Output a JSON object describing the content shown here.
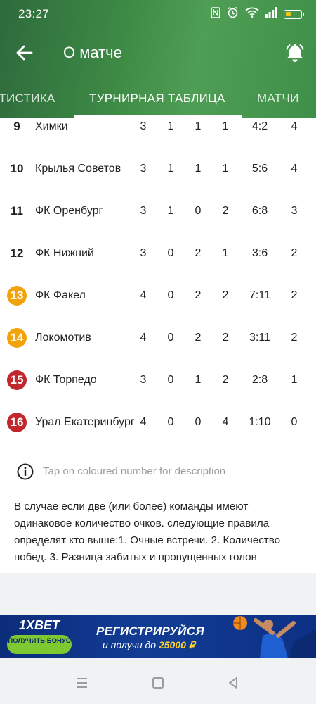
{
  "status_bar": {
    "time": "23:27"
  },
  "app_bar": {
    "title": "О матче"
  },
  "tabs": [
    {
      "label": "АТИСТИКА"
    },
    {
      "label": "ТУРНИРНАЯ ТАБЛИЦА"
    },
    {
      "label": "МАТЧИ"
    }
  ],
  "standings": [
    {
      "pos": "9",
      "team": "Химки",
      "p": "3",
      "w": "1",
      "d": "1",
      "l": "1",
      "goals": "4:2",
      "pts": "4",
      "zone": "none"
    },
    {
      "pos": "10",
      "team": "Крылья Советов",
      "p": "3",
      "w": "1",
      "d": "1",
      "l": "1",
      "goals": "5:6",
      "pts": "4",
      "zone": "none"
    },
    {
      "pos": "11",
      "team": "ФК Оренбург",
      "p": "3",
      "w": "1",
      "d": "0",
      "l": "2",
      "goals": "6:8",
      "pts": "3",
      "zone": "none"
    },
    {
      "pos": "12",
      "team": "ФК Нижний",
      "p": "3",
      "w": "0",
      "d": "2",
      "l": "1",
      "goals": "3:6",
      "pts": "2",
      "zone": "none"
    },
    {
      "pos": "13",
      "team": "ФК Факел",
      "p": "4",
      "w": "0",
      "d": "2",
      "l": "2",
      "goals": "7:11",
      "pts": "2",
      "zone": "orange"
    },
    {
      "pos": "14",
      "team": "Локомотив",
      "p": "4",
      "w": "0",
      "d": "2",
      "l": "2",
      "goals": "3:11",
      "pts": "2",
      "zone": "orange"
    },
    {
      "pos": "15",
      "team": "ФК Торпедо",
      "p": "3",
      "w": "0",
      "d": "1",
      "l": "2",
      "goals": "2:8",
      "pts": "1",
      "zone": "red"
    },
    {
      "pos": "16",
      "team": "Урал Екатеринбург",
      "p": "4",
      "w": "0",
      "d": "0",
      "l": "4",
      "goals": "1:10",
      "pts": "0",
      "zone": "red"
    }
  ],
  "info": {
    "tap_hint": "Tap on coloured number for description",
    "rules": "В случае если две (или более) команды имеют одинаковое количество очков. следующие правила определят кто выше:1. Очные встречи. 2. Количество побед. 3. Разница забитых и пропущенных голов"
  },
  "banner": {
    "logo": "1XBET",
    "button": "ПОЛУЧИТЬ БОНУС",
    "headline": "РЕГИСТРИРУЙСЯ",
    "sub_prefix": "и получи до",
    "sub_amount": "25000 ₽"
  },
  "colors": {
    "orange_zone": "#f2a20b",
    "red_zone": "#c1272d",
    "header_green": "#3d8a45"
  },
  "icons": {
    "status": [
      "nfc-icon",
      "alarm-icon",
      "wifi-icon",
      "signal-icon",
      "battery-icon"
    ],
    "app_bar": [
      "back-arrow-icon",
      "bell-icon"
    ],
    "nav": [
      "menu-icon",
      "home-square-icon",
      "back-triangle-icon"
    ]
  }
}
